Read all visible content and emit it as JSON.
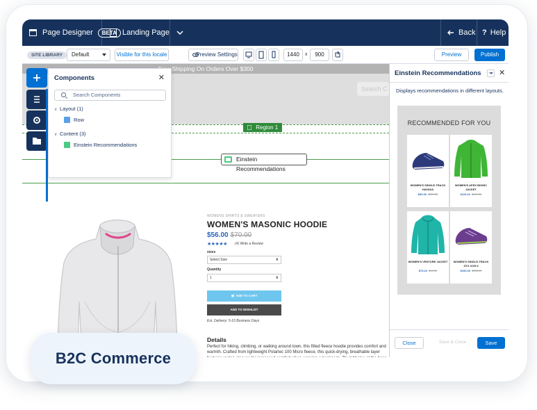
{
  "header": {
    "app_title": "Page Designer",
    "beta_label": "BETA",
    "page_name": "Landing Page",
    "back_label": "Back",
    "help_label": "Help",
    "help_icon": "?"
  },
  "toolbar": {
    "site_library_label": "SITE LIBRARY",
    "locale_select_value": "Default",
    "visible_locale_label": "Visible for this locale",
    "preview_settings_label": "Preview Settings",
    "width_value": "1440",
    "x_label": "x",
    "height_value": "900",
    "preview_label": "Preview",
    "publish_label": "Publish"
  },
  "canvas": {
    "shipping_banner": "Free Shipping On Orders Over $300",
    "search_placeholder": "Search C",
    "region_label": "Region 1",
    "component_label": "Einstein Recommendations",
    "product": {
      "breadcrumb": "WOMENS SHIRTS & SWEATERS",
      "title": "WOMEN'S MASONIC HOODIE",
      "price": "$56.00",
      "old_price": "$70.00",
      "stars": "★★★★★",
      "rating_text": "(4)  Write a Review",
      "sizes_label": "sizes",
      "size_select": "Select Size",
      "quantity_label": "Quantity",
      "quantity_value": "1",
      "add_to_cart": "ADD TO CART",
      "add_to_wishlist": "ADD TO WISHLIST",
      "delivery": "Est. Delivery: 5-10 Business Days",
      "details_heading": "Details",
      "details_text": "Perfect for hiking, climbing, or walking around town, this fitted fleece hoodie provides comfort and warmth. Crafted from lightweight Polartec 100 Micro fleece, this quick-drying, breathable layer features raglan sleeves for increased comfort when carrying a backpack. Thumbholes at the base of ease sleeve let you loop your thumb through for extra coverage. This product contains over 90% bluesign approved fabric - a standard for environmentally responsible production."
    }
  },
  "components_panel": {
    "title": "Components",
    "search_placeholder": "Search Components",
    "groups": [
      {
        "label": "Layout (1)",
        "items": [
          "Row"
        ]
      },
      {
        "label": "Content (3)",
        "items": [
          "Einstein Recommendations"
        ]
      }
    ]
  },
  "right_panel": {
    "title": "Einstein Recommendations",
    "description": "Displays recommendations in different layouts.",
    "preview_heading": "RECOMMENDED FOR YOU",
    "products": [
      {
        "name": "WOMEN'S SINGLE-TRACK HAYASA",
        "price": "$99.00",
        "old": "$119.00",
        "icon": "shoe-navy"
      },
      {
        "name": "WOMEN'S APEX BIONIC JACKET",
        "price": "$119.20",
        "old": "$149.00",
        "icon": "jacket-green"
      },
      {
        "name": "WOMEN'S VENTURE JACKET",
        "price": "$79.20",
        "old": "$99.00",
        "icon": "jacket-teal"
      },
      {
        "name": "WOMEN'S SINGLE-TRACK GTX XCR II",
        "price": "$100.00",
        "old": "$130.00",
        "icon": "shoe-purple"
      }
    ],
    "close_label": "Close",
    "save_close_label": "Save & Close",
    "save_label": "Save"
  },
  "badge": {
    "label": "B2C Commerce"
  },
  "colors": {
    "navy": "#16325c",
    "brand_blue": "#0070d2",
    "region_green": "#2e8b3a",
    "cart_blue": "#6ec6ee"
  }
}
